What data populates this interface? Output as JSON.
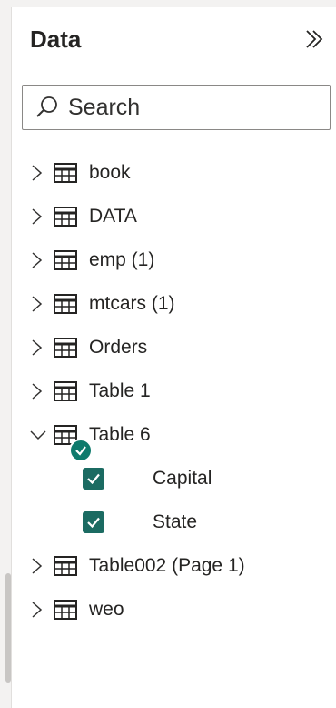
{
  "panel": {
    "title": "Data",
    "collapse_icon": "double-chevron-right-icon",
    "search": {
      "placeholder": "Search",
      "value": ""
    }
  },
  "tables": [
    {
      "name": "book",
      "expanded": false
    },
    {
      "name": "DATA",
      "expanded": false
    },
    {
      "name": "emp (1)",
      "expanded": false
    },
    {
      "name": "mtcars (1)",
      "expanded": false
    },
    {
      "name": "Orders",
      "expanded": false
    },
    {
      "name": "Table 1",
      "expanded": false
    },
    {
      "name": "Table 6",
      "expanded": true,
      "status_badge": "check-badge",
      "fields": [
        {
          "name": "Capital",
          "checked": true
        },
        {
          "name": "State",
          "checked": true
        }
      ]
    },
    {
      "name": "Table002 (Page 1)",
      "expanded": false
    },
    {
      "name": "weo",
      "expanded": false
    }
  ],
  "colors": {
    "checkbox": "#1b6b62",
    "badge": "#0e7a6c",
    "text": "#252423",
    "border": "#8a8886"
  }
}
